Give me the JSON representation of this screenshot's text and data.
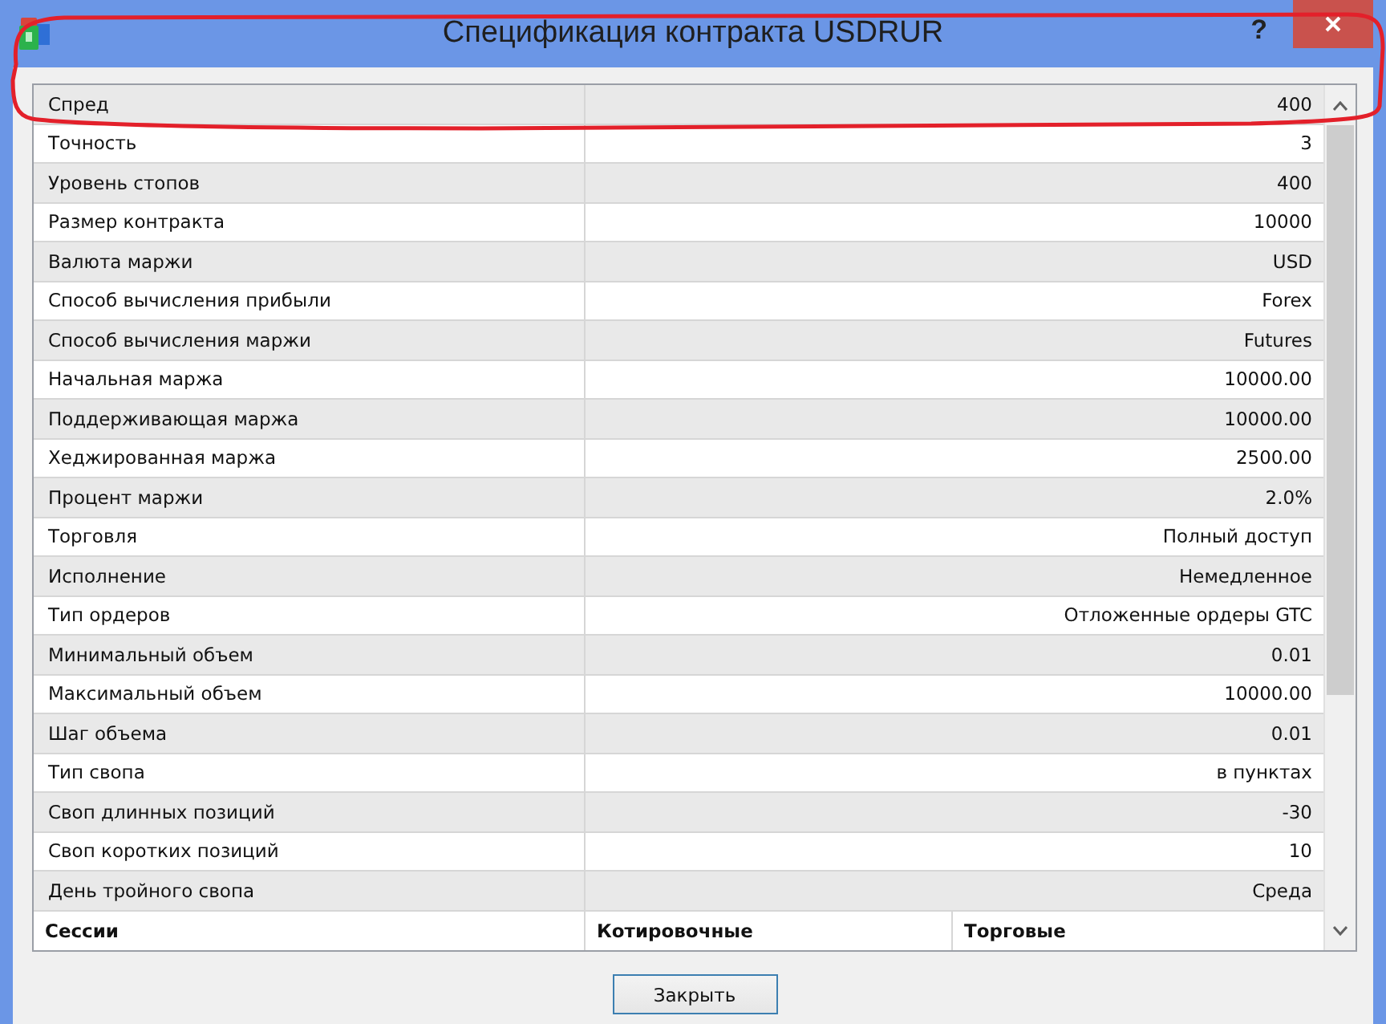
{
  "window": {
    "title": "Спецификация контракта USDRUR",
    "help": "?"
  },
  "table": {
    "rows": [
      {
        "label": "Спред",
        "value": "400"
      },
      {
        "label": "Точность",
        "value": "3"
      },
      {
        "label": "Уровень стопов",
        "value": "400"
      },
      {
        "label": "Размер контракта",
        "value": "10000"
      },
      {
        "label": "Валюта маржи",
        "value": "USD"
      },
      {
        "label": "Способ вычисления прибыли",
        "value": "Forex"
      },
      {
        "label": "Способ вычисления маржи",
        "value": "Futures"
      },
      {
        "label": "Начальная маржа",
        "value": "10000.00"
      },
      {
        "label": "Поддерживающая маржа",
        "value": "10000.00"
      },
      {
        "label": "Хеджированная маржа",
        "value": "2500.00"
      },
      {
        "label": "Процент маржи",
        "value": "2.0%"
      },
      {
        "label": "Торговля",
        "value": "Полный доступ"
      },
      {
        "label": "Исполнение",
        "value": "Немедленное"
      },
      {
        "label": "Тип ордеров",
        "value": "Отложенные ордеры GTC"
      },
      {
        "label": "Минимальный объем",
        "value": "0.01"
      },
      {
        "label": "Максимальный объем",
        "value": "10000.00"
      },
      {
        "label": "Шаг объема",
        "value": "0.01"
      },
      {
        "label": "Тип свопа",
        "value": "в пунктах"
      },
      {
        "label": "Своп длинных позиций",
        "value": "-30"
      },
      {
        "label": "Своп коротких позиций",
        "value": "10"
      },
      {
        "label": "День тройного свопа",
        "value": "Среда"
      }
    ],
    "session_columns": [
      "Сессии",
      "Котировочные",
      "Торговые"
    ]
  },
  "buttons": [
    {
      "label": "Закрыть",
      "focused": true
    }
  ]
}
